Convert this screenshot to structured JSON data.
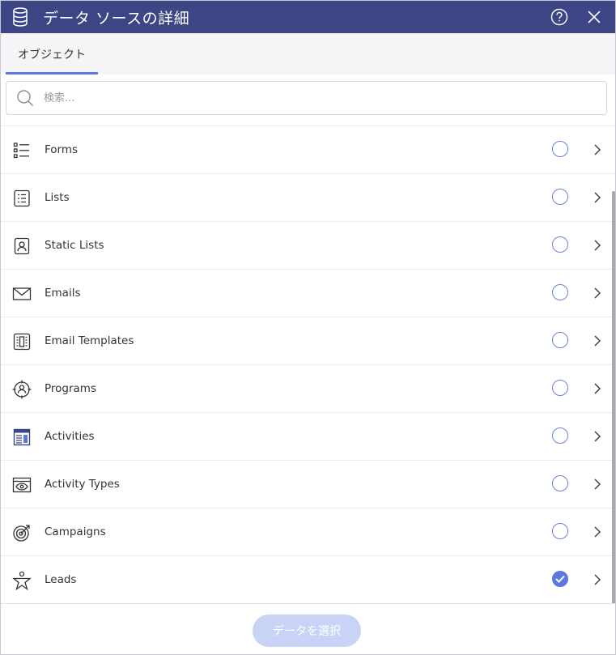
{
  "header": {
    "title": "データ ソースの詳細",
    "icons": {
      "datasource": "database-icon",
      "help": "help-circle-icon",
      "close": "close-icon"
    }
  },
  "tabs": [
    {
      "label": "オブジェクト",
      "active": true
    }
  ],
  "search": {
    "placeholder": "検索...",
    "value": "",
    "icon": "search-icon"
  },
  "items": [
    {
      "label": "Forms",
      "icon": "forms-list-icon",
      "selected": false
    },
    {
      "label": "Lists",
      "icon": "list-doc-icon",
      "selected": false
    },
    {
      "label": "Static Lists",
      "icon": "static-list-icon",
      "selected": false
    },
    {
      "label": "Emails",
      "icon": "envelope-icon",
      "selected": false
    },
    {
      "label": "Email Templates",
      "icon": "email-template-icon",
      "selected": false
    },
    {
      "label": "Programs",
      "icon": "program-target-icon",
      "selected": false
    },
    {
      "label": "Activities",
      "icon": "activities-icon",
      "selected": false
    },
    {
      "label": "Activity Types",
      "icon": "eye-window-icon",
      "selected": false
    },
    {
      "label": "Campaigns",
      "icon": "bullseye-icon",
      "selected": false
    },
    {
      "label": "Leads",
      "icon": "star-person-icon",
      "selected": true
    }
  ],
  "footer": {
    "select_label": "データを選択",
    "enabled": false
  },
  "colors": {
    "header_bg": "#3d4585",
    "accent": "#5b78de",
    "button_disabled": "#c9d3f6"
  }
}
